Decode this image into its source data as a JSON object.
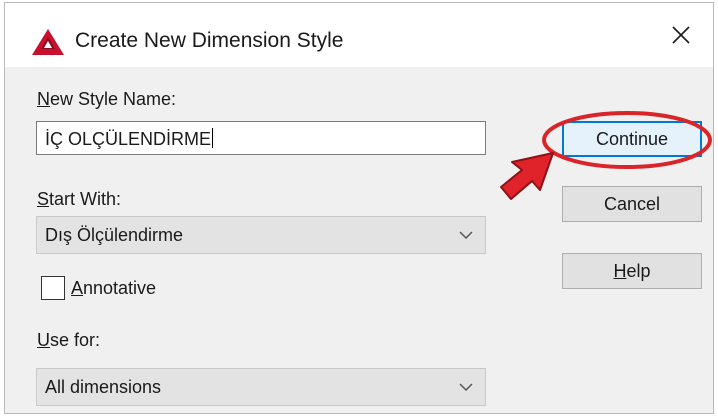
{
  "dialog": {
    "title": "Create New Dimension Style",
    "app_icon": "autocad-a-icon",
    "close_icon": "close-x-icon"
  },
  "form": {
    "new_style_name_label_first": "N",
    "new_style_name_label_rest": "ew Style Name:",
    "new_style_name_value": "İÇ OLÇÜLENDİRME",
    "start_with_label_first": "S",
    "start_with_label_rest": "tart With:",
    "start_with_value": "Dış Ölçülendirme",
    "annotative_label_first": "A",
    "annotative_label_rest": "nnotative",
    "annotative_checked": false,
    "use_for_label_first": "U",
    "use_for_label_rest": "se for:",
    "use_for_value": "All dimensions"
  },
  "buttons": {
    "continue_label": "Continue",
    "cancel_label": "Cancel",
    "help_label_first": "H",
    "help_label_rest": "elp"
  },
  "annotations": {
    "highlight_color": "#d9252a",
    "arrow_icon": "red-pointer-arrow-icon",
    "circle_icon": "red-highlight-ellipse-icon"
  },
  "colors": {
    "dialog_bg": "#f0f0f0",
    "titlebar_bg": "#ffffff",
    "primary_border": "#0078d7",
    "autocad_red": "#c8102e"
  }
}
